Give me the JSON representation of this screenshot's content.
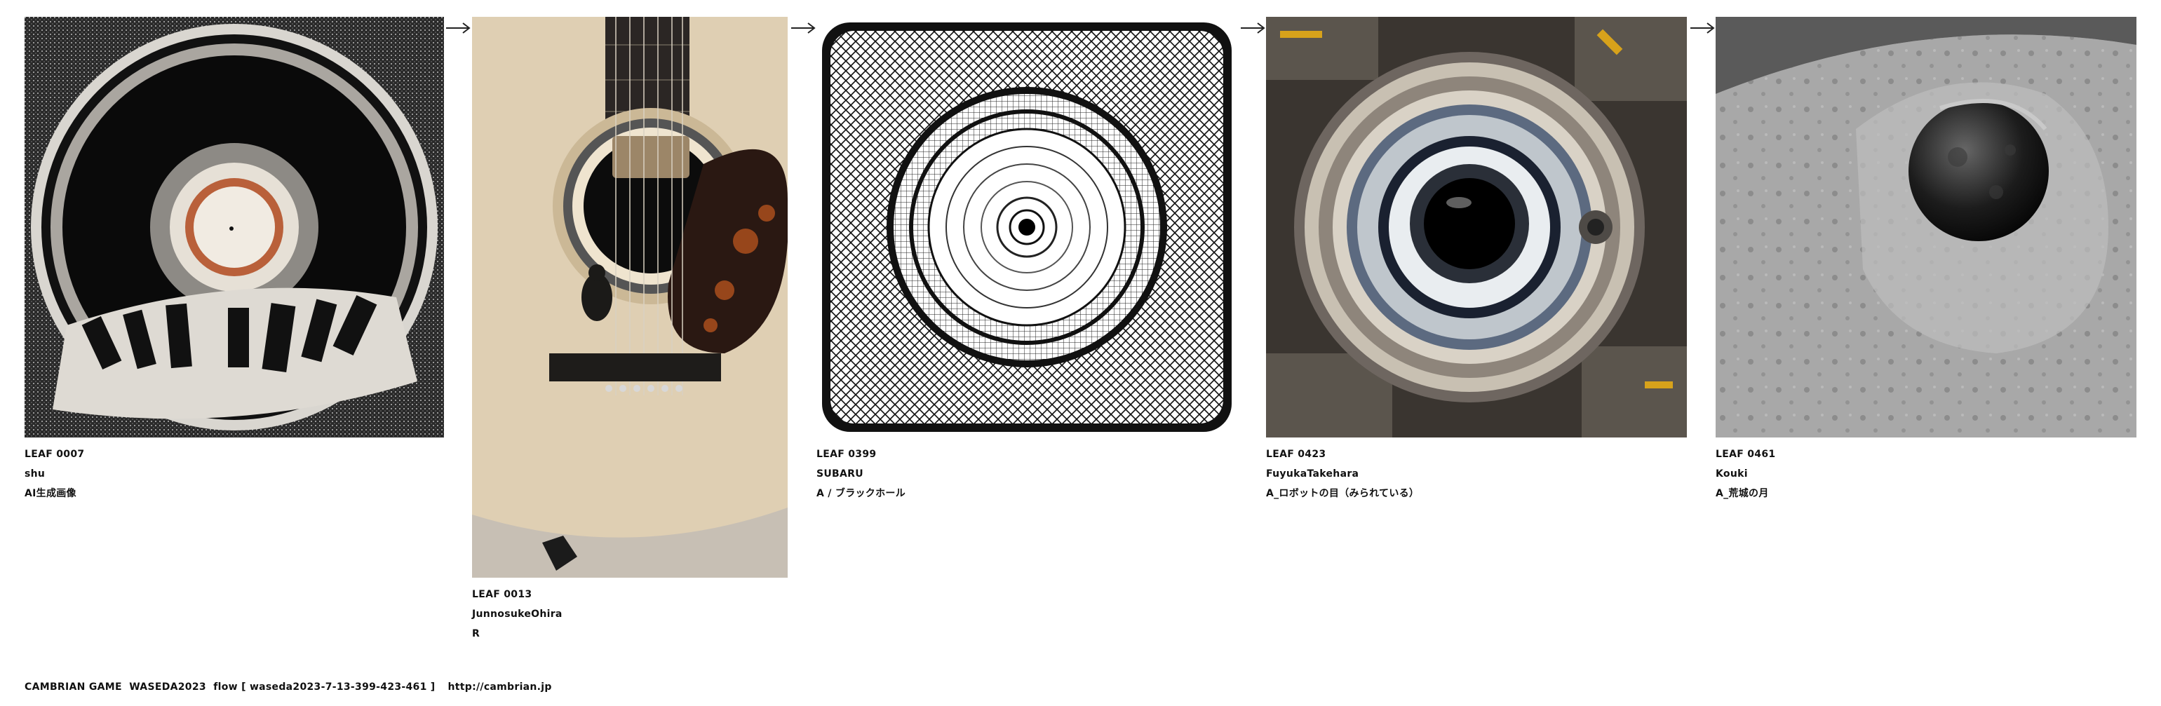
{
  "leaves": [
    {
      "id": "LEAF 0007",
      "author": "shu",
      "title": "AI生成画像",
      "image_icon": "vinyl-record-art-image"
    },
    {
      "id": "LEAF 0013",
      "author": "JunnosukeOhira",
      "title": "R",
      "image_icon": "guitar-beetle-photo"
    },
    {
      "id": "LEAF 0399",
      "author": "SUBARU",
      "title": "A / ブラックホール",
      "image_icon": "blackhole-ornament-art"
    },
    {
      "id": "LEAF 0423",
      "author": "FuyukaTakehara",
      "title": "A_ロボットの目（みられている）",
      "image_icon": "robot-eye-image"
    },
    {
      "id": "LEAF 0461",
      "author": "Kouki",
      "title": "A_荒城の月",
      "image_icon": "moon-surface-image"
    }
  ],
  "footer": {
    "text": "CAMBRIAN GAME  WASEDA2023  flow [ waseda2023-7-13-399-423-461 ]",
    "url": "http://cambrian.jp"
  },
  "colors": {
    "text": "#111111",
    "background": "#ffffff"
  }
}
